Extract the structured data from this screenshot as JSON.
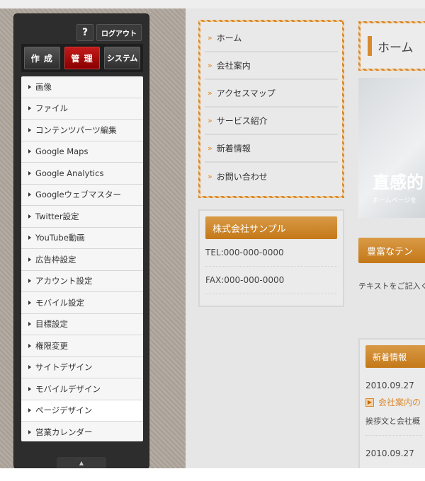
{
  "admin": {
    "help_label": "?",
    "logout_label": "ログアウト",
    "tabs": [
      {
        "label": "作 成"
      },
      {
        "label": "管 理"
      },
      {
        "label": "システム"
      }
    ],
    "menu": [
      {
        "label": "画像"
      },
      {
        "label": "ファイル"
      },
      {
        "label": "コンテンツパーツ編集"
      },
      {
        "label": "Google Maps"
      },
      {
        "label": "Google Analytics"
      },
      {
        "label": "Googleウェブマスター"
      },
      {
        "label": "Twitter設定"
      },
      {
        "label": "YouTube動画"
      },
      {
        "label": "広告枠設定"
      },
      {
        "label": "アカウント設定"
      },
      {
        "label": "モバイル設定"
      },
      {
        "label": "目標設定"
      },
      {
        "label": "権限変更"
      },
      {
        "label": "サイトデザイン"
      },
      {
        "label": "モバイルデザイン"
      },
      {
        "label": "ページデザイン"
      },
      {
        "label": "営業カレンダー"
      }
    ],
    "scroll_up": "▲"
  },
  "site": {
    "nav": [
      {
        "label": "ホーム"
      },
      {
        "label": "会社案内"
      },
      {
        "label": "アクセスマップ"
      },
      {
        "label": "サービス紹介"
      },
      {
        "label": "新着情報"
      },
      {
        "label": "お問い合わせ"
      }
    ],
    "nav_chevron": "»",
    "company": {
      "title": "株式会社サンプル",
      "tel": "TEL:000-000-0000",
      "fax": "FAX:000-000-0000"
    },
    "main": {
      "title": "ホーム",
      "hero_big": "直感的",
      "hero_small": "ホームページを",
      "template_btn": "豊富なテン",
      "text_prompt": "テキストをご記入く",
      "news": {
        "title": "新着情報",
        "date1": "2010.09.27",
        "link1": "会社案内の",
        "desc1": "挨拶文と会社概",
        "date2": "2010.09.27"
      }
    }
  }
}
